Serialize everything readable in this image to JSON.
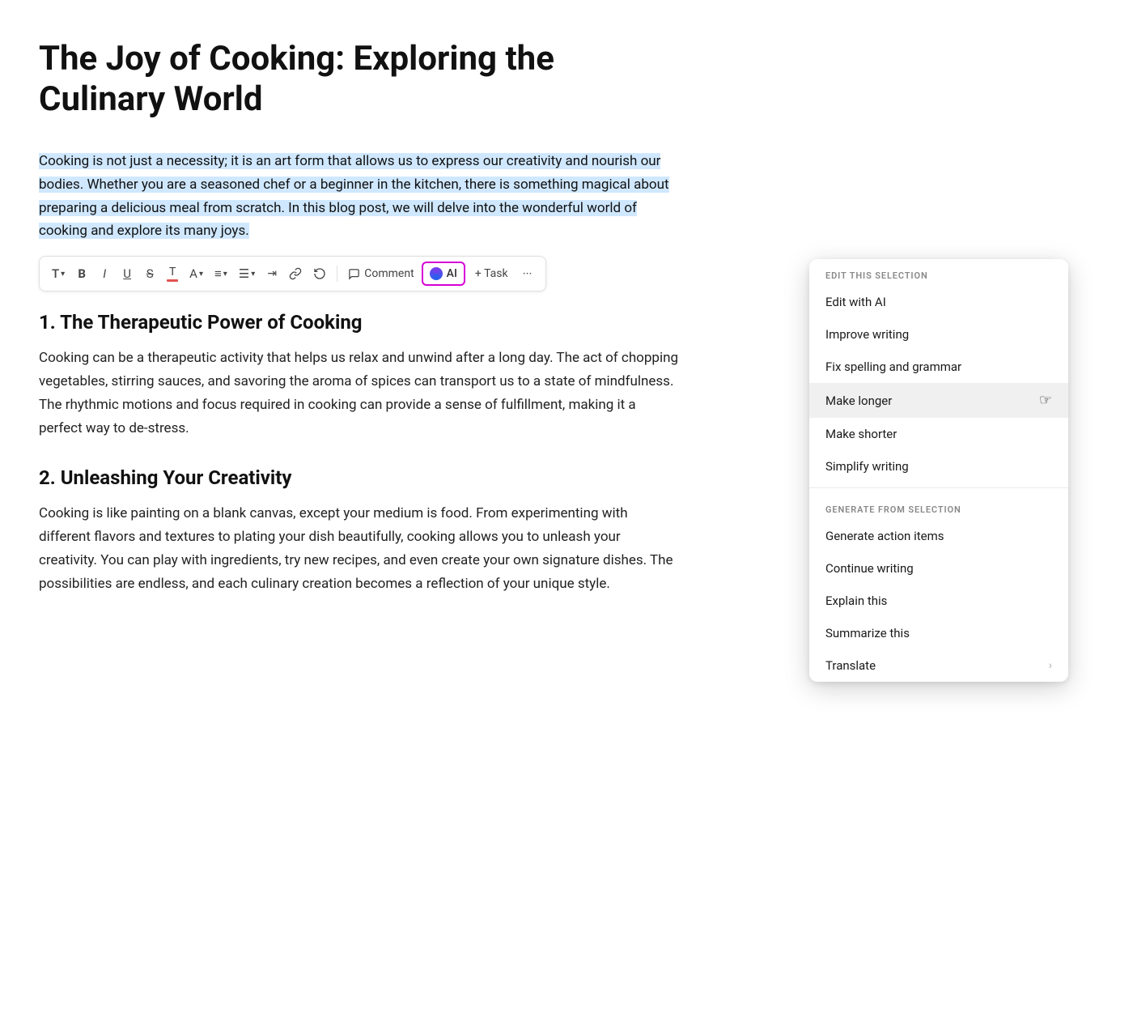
{
  "document": {
    "title": "The Joy of Cooking: Exploring the Culinary World",
    "selected_paragraph": "Cooking is not just a necessity; it is an art form that allows us to express our creativity and nourish our bodies. Whether you are a seasoned chef or a beginner in the kitchen, there is something magical about preparing a delicious meal from scratch. In this blog post, we will delve into the wonderful world of cooking and explore its many joys.",
    "section1": {
      "heading": "1. The Therapeutic Power of Cooking",
      "body": "Cooking can be a therapeutic activity that helps us relax and unwind after a long day. The act of chopping vegetables, stirring sauces, and savoring the aroma of spices can transport us to a state of mindfulness. The rhythmic motions and focus required in cooking can provide a sense of fulfillment, making it a perfect way to de-stress."
    },
    "section2": {
      "heading": "2. Unleashing Your Creativity",
      "body": "Cooking is like painting on a blank canvas, except your medium is food. From experimenting with different flavors and textures to plating your dish beautifully, cooking allows you to unleash your creativity. You can play with ingredients, try new recipes, and even create your own signature dishes. The possibilities are endless, and each culinary creation becomes a reflection of your unique style."
    }
  },
  "toolbar": {
    "text_label": "T",
    "bold_label": "B",
    "italic_label": "I",
    "underline_label": "U",
    "strike_label": "S",
    "color_label": "T",
    "font_label": "A",
    "align_label": "≡",
    "list_label": "☰",
    "indent_label": "⇥",
    "link_label": "🔗",
    "rotate_label": "↺",
    "comment_label": "Comment",
    "ai_label": "AI",
    "task_label": "+ Task",
    "more_label": "···"
  },
  "ai_menu": {
    "section1_label": "EDIT THIS SELECTION",
    "items_edit": [
      {
        "id": "edit-with-ai",
        "label": "Edit with AI",
        "has_arrow": false
      },
      {
        "id": "improve-writing",
        "label": "Improve writing",
        "has_arrow": false
      },
      {
        "id": "fix-spelling",
        "label": "Fix spelling and grammar",
        "has_arrow": false
      },
      {
        "id": "make-longer",
        "label": "Make longer",
        "has_arrow": false,
        "active": true
      },
      {
        "id": "make-shorter",
        "label": "Make shorter",
        "has_arrow": false
      },
      {
        "id": "simplify-writing",
        "label": "Simplify writing",
        "has_arrow": false
      }
    ],
    "section2_label": "GENERATE FROM SELECTION",
    "items_generate": [
      {
        "id": "generate-action-items",
        "label": "Generate action items",
        "has_arrow": false
      },
      {
        "id": "continue-writing",
        "label": "Continue writing",
        "has_arrow": false
      },
      {
        "id": "explain-this",
        "label": "Explain this",
        "has_arrow": false
      },
      {
        "id": "summarize-this",
        "label": "Summarize this",
        "has_arrow": false
      },
      {
        "id": "translate",
        "label": "Translate",
        "has_arrow": true
      }
    ]
  }
}
